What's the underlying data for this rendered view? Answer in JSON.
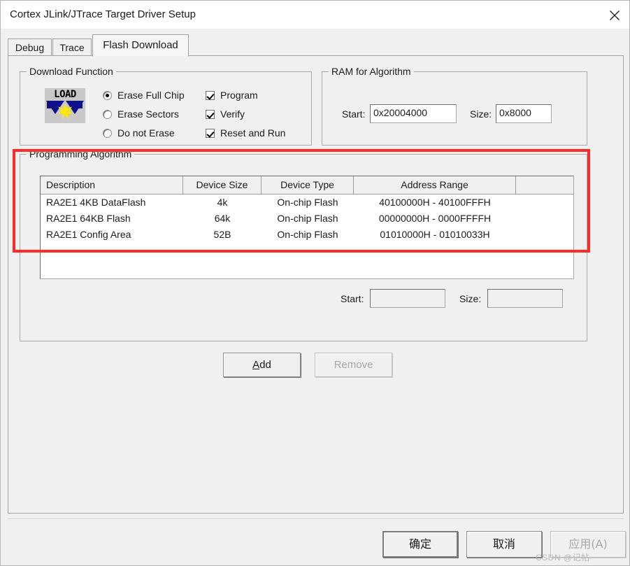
{
  "window": {
    "title": "Cortex JLink/JTrace Target Driver Setup",
    "close_icon": "close-icon"
  },
  "tabs": [
    {
      "label": "Debug",
      "active": false
    },
    {
      "label": "Trace",
      "active": false
    },
    {
      "label": "Flash Download",
      "active": true
    }
  ],
  "download_function": {
    "title": "Download Function",
    "icon": "load-icon",
    "icon_text": "LOAD",
    "radios": [
      {
        "label": "Erase Full Chip",
        "checked": true
      },
      {
        "label": "Erase Sectors",
        "checked": false
      },
      {
        "label": "Do not Erase",
        "checked": false
      }
    ],
    "checkboxes": [
      {
        "label": "Program",
        "checked": true
      },
      {
        "label": "Verify",
        "checked": true
      },
      {
        "label": "Reset and Run",
        "checked": true
      }
    ]
  },
  "ram_for_algorithm": {
    "title": "RAM for Algorithm",
    "start_label": "Start:",
    "start_value": "0x20004000",
    "size_label": "Size:",
    "size_value": "0x8000"
  },
  "programming_algorithm": {
    "title": "Programming Algorithm",
    "columns": [
      "Description",
      "Device Size",
      "Device Type",
      "Address Range",
      ""
    ],
    "rows": [
      {
        "description": "RA2E1 4KB DataFlash",
        "device_size": "4k",
        "device_type": "On-chip Flash",
        "address_range": "40100000H - 40100FFFH"
      },
      {
        "description": "RA2E1 64KB Flash",
        "device_size": "64k",
        "device_type": "On-chip Flash",
        "address_range": "00000000H - 0000FFFFH"
      },
      {
        "description": "RA2E1 Config Area",
        "device_size": "52B",
        "device_type": "On-chip Flash",
        "address_range": "01010000H - 01010033H"
      }
    ],
    "start_label": "Start:",
    "start_value": "",
    "size_label": "Size:",
    "size_value": ""
  },
  "list_buttons": {
    "add": "Add",
    "add_accel": "A",
    "add_rest": "dd",
    "remove": "Remove"
  },
  "dialog_buttons": {
    "ok": "确定",
    "cancel": "取消",
    "apply": "应用(A)"
  },
  "annotation": {
    "highlight_color": "#fb2c2c"
  },
  "watermark": {
    "text": "CSDN @记帖"
  }
}
